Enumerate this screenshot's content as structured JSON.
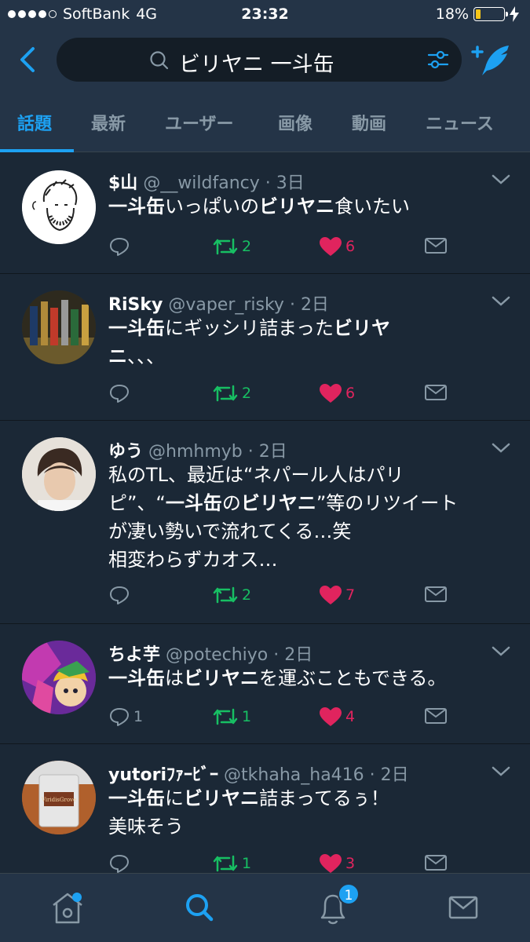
{
  "status_bar": {
    "carrier": "SoftBank",
    "network": "4G",
    "time": "23:32",
    "battery": "18%",
    "battery_level": 0.18
  },
  "search": {
    "query": "ビリヤニ 一斗缶"
  },
  "tabs": [
    {
      "label": "話題",
      "active": true
    },
    {
      "label": "最新"
    },
    {
      "label": "ユーザー"
    },
    {
      "label": "画像"
    },
    {
      "label": "動画"
    },
    {
      "label": "ニュース"
    }
  ],
  "tweets": [
    {
      "name": "$山",
      "handle": "@__wildfancy",
      "time": "· 3日",
      "lines": [
        [
          {
            "t": "一斗缶",
            "b": true
          },
          {
            "t": "いっぱいの"
          },
          {
            "t": "ビリヤニ",
            "b": true
          },
          {
            "t": "食いたい"
          }
        ]
      ],
      "replies": "",
      "retweets": "2",
      "likes": "6"
    },
    {
      "name": "RiSky",
      "handle": "@vaper_risky",
      "time": "· 2日",
      "lines": [
        [
          {
            "t": "一斗缶",
            "b": true
          },
          {
            "t": "にギッシリ詰まった"
          },
          {
            "t": "ビリヤ",
            "b": true
          }
        ],
        [
          {
            "t": "ニ",
            "b": true
          },
          {
            "t": "、、、"
          }
        ]
      ],
      "replies": "",
      "retweets": "2",
      "likes": "6"
    },
    {
      "name": "ゆう",
      "handle": "@hmhmyb",
      "time": "· 2日",
      "lines": [
        [
          {
            "t": "私のTL、最近は“ネパール人はパリ"
          }
        ],
        [
          {
            "t": "ピ”、“"
          },
          {
            "t": "一斗缶",
            "b": true
          },
          {
            "t": "の"
          },
          {
            "t": "ビリヤニ",
            "b": true
          },
          {
            "t": "”等のリツイート"
          }
        ],
        [
          {
            "t": "が凄い勢いで流れてくる…笑"
          }
        ],
        [
          {
            "t": "相変わらずカオス…"
          }
        ]
      ],
      "replies": "",
      "retweets": "2",
      "likes": "7"
    },
    {
      "name": "ちよ芋",
      "handle": "@potechiyo",
      "time": "· 2日",
      "lines": [
        [
          {
            "t": "一斗缶",
            "b": true
          },
          {
            "t": "は"
          },
          {
            "t": "ビリヤニ",
            "b": true
          },
          {
            "t": "を運ぶこともできる。"
          }
        ]
      ],
      "replies": "1",
      "retweets": "1",
      "likes": "4"
    },
    {
      "name": "yutoriﾌｧｰﾋﾞｰ",
      "handle": "@tkhaha_ha416",
      "time": "· 2日",
      "lines": [
        [
          {
            "t": "一斗缶",
            "b": true
          },
          {
            "t": "に"
          },
          {
            "t": "ビリヤニ",
            "b": true
          },
          {
            "t": "詰まってるぅ！"
          }
        ],
        [
          {
            "t": "美味そう"
          }
        ]
      ],
      "replies": "",
      "retweets": "1",
      "likes": "3"
    }
  ],
  "avatar_image_labels": {
    "tweet_5": "ViridisGrove"
  },
  "nav": {
    "notification_badge": "1"
  },
  "colors": {
    "accent": "#1da1f2",
    "retweet": "#17bf63",
    "like": "#e0245e",
    "background": "#1b2836",
    "header": "#243447"
  }
}
